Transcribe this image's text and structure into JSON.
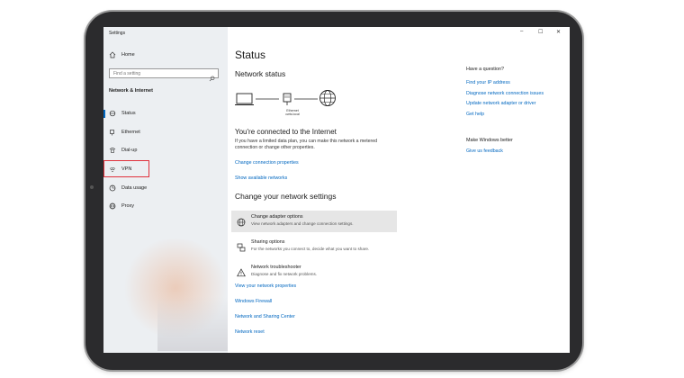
{
  "window": {
    "title": "Settings",
    "controls": [
      "–",
      "☐",
      "✕"
    ]
  },
  "sidebar": {
    "home_label": "Home",
    "search_placeholder": "Find a setting",
    "section_title": "Network & Internet",
    "items": [
      {
        "label": "Status",
        "icon": "status-icon"
      },
      {
        "label": "Ethernet",
        "icon": "ethernet-icon"
      },
      {
        "label": "Dial-up",
        "icon": "dialup-icon"
      },
      {
        "label": "VPN",
        "icon": "vpn-icon"
      },
      {
        "label": "Data usage",
        "icon": "data-usage-icon"
      },
      {
        "label": "Proxy",
        "icon": "proxy-icon"
      }
    ],
    "selected": "Status",
    "highlighted": "VPN"
  },
  "main": {
    "title": "Status",
    "network_status_heading": "Network status",
    "diagram": {
      "adapter_label_line1": "Ethernet",
      "adapter_label_line2": "cwts.local"
    },
    "connected_title": "You're connected to the Internet",
    "connected_desc": "If you have a limited data plan, you can make this network a metered connection or change other properties.",
    "links_top": [
      "Change connection properties",
      "Show available networks"
    ],
    "change_heading": "Change your network settings",
    "options": [
      {
        "title": "Change adapter options",
        "sub": "View network adapters and change connection settings.",
        "icon": "adapter-globe-icon"
      },
      {
        "title": "Sharing options",
        "sub": "For the networks you connect to, decide what you want to share.",
        "icon": "sharing-icon"
      },
      {
        "title": "Network troubleshooter",
        "sub": "Diagnose and fix network problems.",
        "icon": "warning-icon"
      }
    ],
    "links_bottom": [
      "View your network properties",
      "Windows Firewall",
      "Network and Sharing Center",
      "Network reset"
    ]
  },
  "right_panel": {
    "question_heading": "Have a question?",
    "question_links": [
      "Find your IP address",
      "Diagnose network connection issues",
      "Update network adapter or driver",
      "Get help"
    ],
    "better_heading": "Make Windows better",
    "better_links": [
      "Give us feedback"
    ]
  },
  "colors": {
    "accent": "#0067c0",
    "highlight_border": "#e0313c",
    "sidebar_bg": "#eceff2",
    "device_frame": "#2b2b2d"
  }
}
